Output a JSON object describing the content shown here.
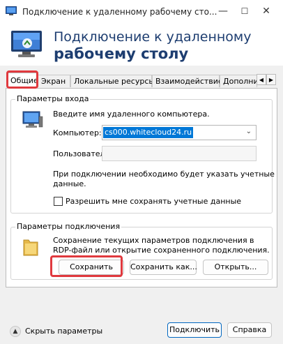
{
  "window": {
    "title": "Подключение к удаленному рабочему сто...",
    "controls": {
      "minimize": "—",
      "maximize": "☐",
      "close": "✕"
    }
  },
  "banner": {
    "line1": "Подключение к удаленному",
    "line2": "рабочему столу",
    "icon": "remote-desktop-computer-icon"
  },
  "tabs": [
    {
      "label": "Общие",
      "active": true
    },
    {
      "label": "Экран"
    },
    {
      "label": "Локальные ресурсы"
    },
    {
      "label": "Взаимодействие"
    },
    {
      "label": "Дополни"
    }
  ],
  "tab_scroll": {
    "left": "◀",
    "right": "▶"
  },
  "logon": {
    "legend": "Параметры входа",
    "prompt": "Введите имя удаленного компьютера.",
    "computer_label": "Компьютер:",
    "computer_value": "cs000.whitecloud24.ru",
    "user_label": "Пользователь:",
    "user_value": "",
    "info_line1": "При подключении необходимо будет указать учетные",
    "info_line2": "данные.",
    "save_creds_label": "Разрешить мне сохранять учетные данные",
    "save_creds_checked": false
  },
  "connection": {
    "legend": "Параметры подключения",
    "desc_line1": "Сохранение текущих параметров подключения в",
    "desc_line2": "RDP-файл или открытие сохраненного подключения.",
    "save_label": "Сохранить",
    "save_as_label": "Сохранить как...",
    "open_label": "Открыть..."
  },
  "footer": {
    "hide_options_label": "Скрыть параметры",
    "connect_label": "Подключить",
    "help_label": "Справка"
  },
  "colors": {
    "highlight": "#e0393e",
    "accent": "#0078d7",
    "heading": "#1d3d70"
  }
}
